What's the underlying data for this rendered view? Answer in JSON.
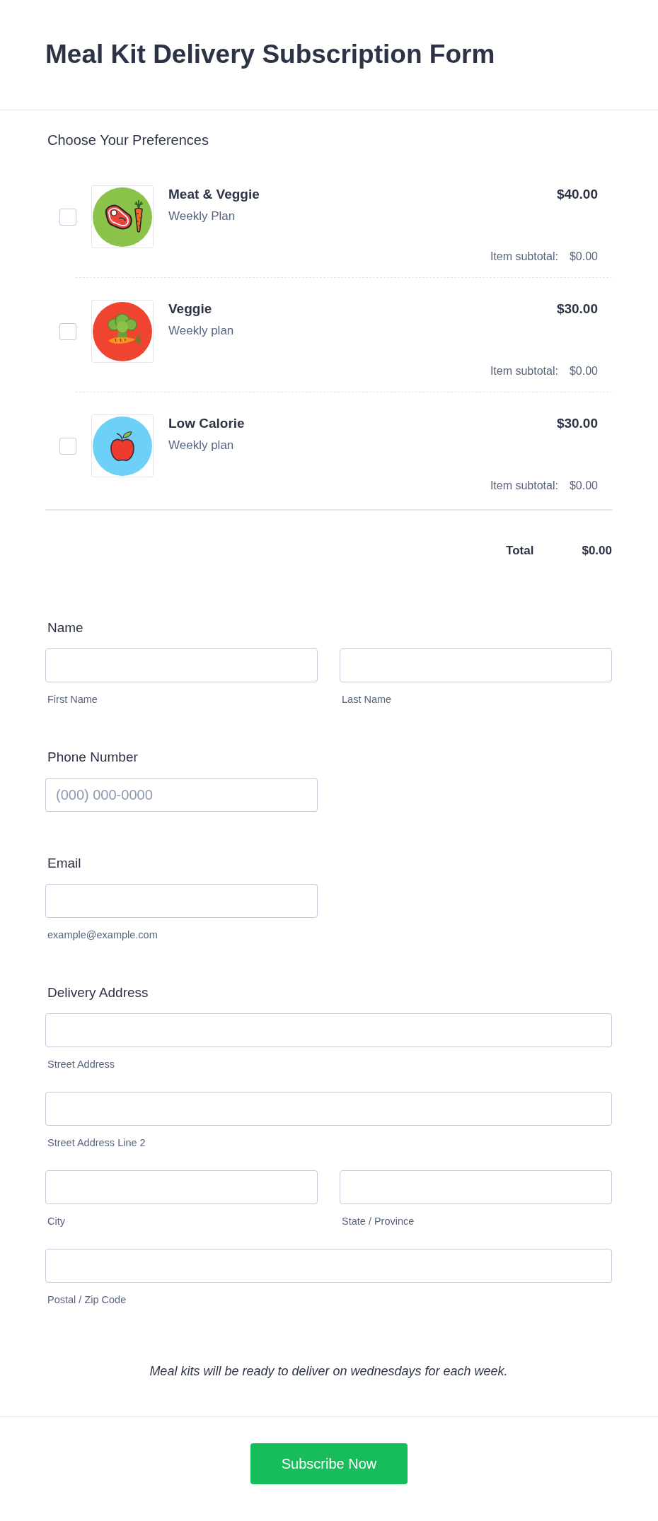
{
  "header": {
    "title": "Meal Kit Delivery Subscription Form"
  },
  "products": {
    "label": "Choose Your Preferences",
    "items": [
      {
        "kind": "steak",
        "name": "Meat & Veggie",
        "description": "Weekly Plan",
        "price": "$40.00",
        "subtotal_label": "Item subtotal:",
        "subtotal": "$0.00",
        "checked": false
      },
      {
        "kind": "broccoli",
        "name": "Veggie",
        "description": "Weekly plan",
        "price": "$30.00",
        "subtotal_label": "Item subtotal:",
        "subtotal": "$0.00",
        "checked": false
      },
      {
        "kind": "apple",
        "name": "Low Calorie",
        "description": "Weekly plan",
        "price": "$30.00",
        "subtotal_label": "Item subtotal:",
        "subtotal": "$0.00",
        "checked": false
      }
    ],
    "total_label": "Total",
    "total": "$0.00"
  },
  "sections": [
    {
      "label": "Name",
      "fields": [
        {
          "kind": "half",
          "sublabel": "First Name"
        },
        {
          "kind": "half",
          "sublabel": "Last Name"
        }
      ]
    },
    {
      "label": "Phone Number",
      "fields": [
        {
          "kind": "half",
          "placeholder": "(000) 000-0000"
        }
      ]
    },
    {
      "label": "Email",
      "fields": [
        {
          "kind": "half",
          "sublabel": "example@example.com"
        }
      ]
    },
    {
      "label": "Delivery Address",
      "fields": [
        {
          "kind": "full",
          "sublabel": "Street Address"
        },
        {
          "kind": "full",
          "sublabel": "Street Address Line 2"
        },
        {
          "kind": "half",
          "sublabel": "City"
        },
        {
          "kind": "half",
          "sublabel": "State / Province"
        },
        {
          "kind": "full",
          "sublabel": "Postal / Zip Code"
        }
      ]
    }
  ],
  "note": "Meal kits will be ready to deliver on wednesdays for each week.",
  "submit_button": "Subscribe Now"
}
